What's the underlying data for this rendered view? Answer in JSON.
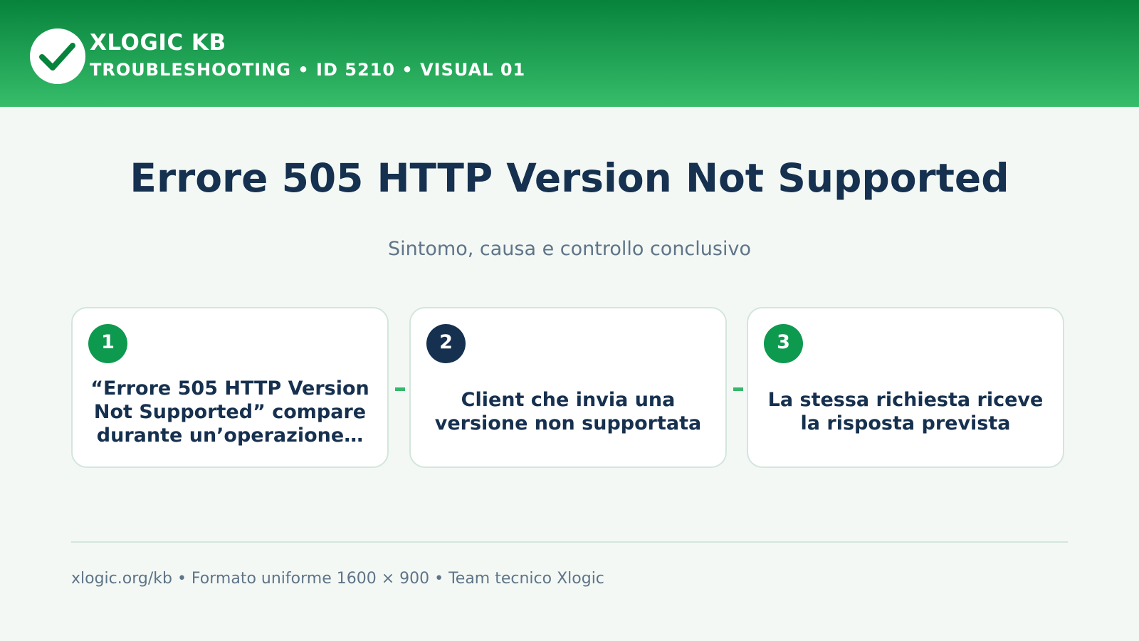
{
  "header": {
    "brand": "XLOGIC KB",
    "subtitle": "TROUBLESHOOTING • ID 5210 • VISUAL 01",
    "logo_icon": "check-icon"
  },
  "main": {
    "title": "Errore 505 HTTP Version Not Supported",
    "subtitle": "Sintomo, causa e controllo conclusivo"
  },
  "steps": [
    {
      "number": "1",
      "text": "“Errore 505 HTTP Version Not Supported” compare durante un’operazione…",
      "color": "#0d9a4f"
    },
    {
      "number": "2",
      "text": "Client che invia una versione non supportata",
      "color": "#16304f"
    },
    {
      "number": "3",
      "text": "La stessa richiesta riceve la risposta prevista",
      "color": "#0d9a4f"
    }
  ],
  "footer": {
    "text": "xlogic.org/kb • Formato uniforme 1600 × 900 • Team tecnico Xlogic"
  },
  "colors": {
    "header_top": "#07833c",
    "header_bottom": "#36bd6a",
    "accent": "#35b86a",
    "navy": "#16304f",
    "background": "#f3f8f5"
  }
}
